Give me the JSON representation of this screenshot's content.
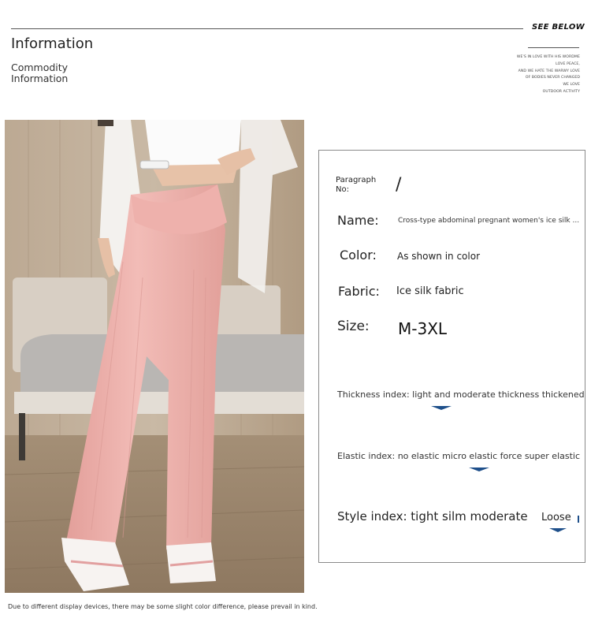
{
  "header": {
    "title": "Information",
    "subtitle_line1": "Commodity",
    "subtitle_line2": "Information",
    "see_below": "SEE BELOW",
    "poem": [
      "WE'S IN LOVE WITH HIS WORDME",
      "LOVE PEACE,",
      "AND WE HATE THE WARWY LOVE",
      "OF BODIES NEVER CHANGED",
      "WE LOVE",
      "OUTDOOR ACTIVITY"
    ]
  },
  "photo": {
    "description": "product-photo"
  },
  "card": {
    "paragraph_label": "Paragraph No:",
    "paragraph_value": "/",
    "name_label": "Name:",
    "name_value": "Cross-type abdominal pregnant women's ice silk ...",
    "color_label": "Color:",
    "color_value": "As shown in color",
    "fabric_label": "Fabric:",
    "fabric_value": "Ice silk fabric",
    "size_label": "Size:",
    "size_value": "M-3XL",
    "thickness_text": "Thickness index: light and moderate thickness thickened",
    "elastic_text": "Elastic index: no elastic micro elastic force super elastic",
    "style_text": "Style index: tight silm moderate",
    "style_loose": "Loose"
  },
  "footer": {
    "note": "Due to different display devices, there may be some slight color difference, please prevail in kind."
  },
  "colors": {
    "accent": "#1e4f8a",
    "pants": "#eeb1ac",
    "border": "#8a8a8a"
  }
}
